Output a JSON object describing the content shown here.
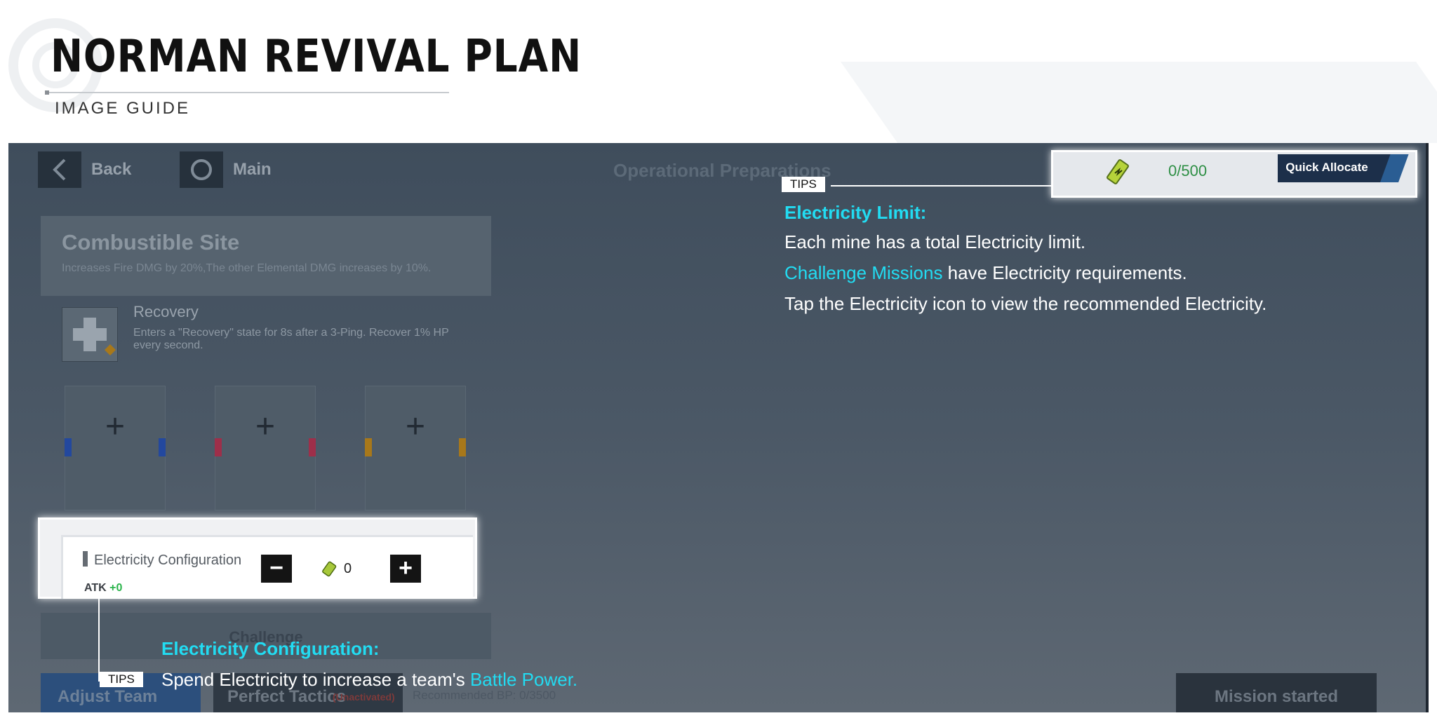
{
  "guide": {
    "title": "NORMAN REVIVAL PLAN",
    "subtitle": "IMAGE GUIDE"
  },
  "nav": {
    "back_label": "Back",
    "main_label": "Main"
  },
  "screen_title": "Operational Preparations",
  "site": {
    "name": "Combustible Site",
    "description": "Increases Fire DMG by 20%,The other Elemental DMG increases by 10%."
  },
  "skill": {
    "name": "Recovery",
    "description": " Enters a \"Recovery\" state for 8s after a 3-Ping. Recover 1% HP every second."
  },
  "slots": [
    {
      "plus": "+",
      "color": "#23489e"
    },
    {
      "plus": "+",
      "color": "#9e2f4a"
    },
    {
      "plus": "+",
      "color": "#a8781a"
    }
  ],
  "electricity_config": {
    "label": "Electricity Configuration",
    "atk_label": "ATK",
    "atk_value": "+0",
    "minus": "−",
    "plus": "+",
    "value": "0"
  },
  "electricity_header": {
    "value": "0/500",
    "quick_allocate_label": "Quick Allocate",
    "icon": "battery-bolt-icon"
  },
  "buttons": {
    "challenge": "Challenge",
    "adjust_team": "Adjust Team",
    "perfect_tactics": "Perfect Tactics",
    "perfect_tactics_status": "(Unactivated)",
    "recommended_bp": "Recommended BP: 0/3500",
    "mission_started": "Mission started"
  },
  "tips": {
    "tag": "TIPS",
    "limit": {
      "heading": "Electricity Limit:",
      "line1": "Each mine has a total Electricity limit.",
      "line2_highlight": "Challenge Missions",
      "line2_rest": " have Electricity requirements.",
      "line3": "Tap the Electricity icon to view the recommended Electricity."
    },
    "config": {
      "heading": "Electricity Configuration:",
      "line1": "Spend Electricity to increase a team's ",
      "line1_highlight": "Battle Power."
    }
  },
  "colors": {
    "tip_highlight": "#22dcf2",
    "electricity_value": "#2e8f45",
    "atk_bonus": "#29b34a"
  }
}
